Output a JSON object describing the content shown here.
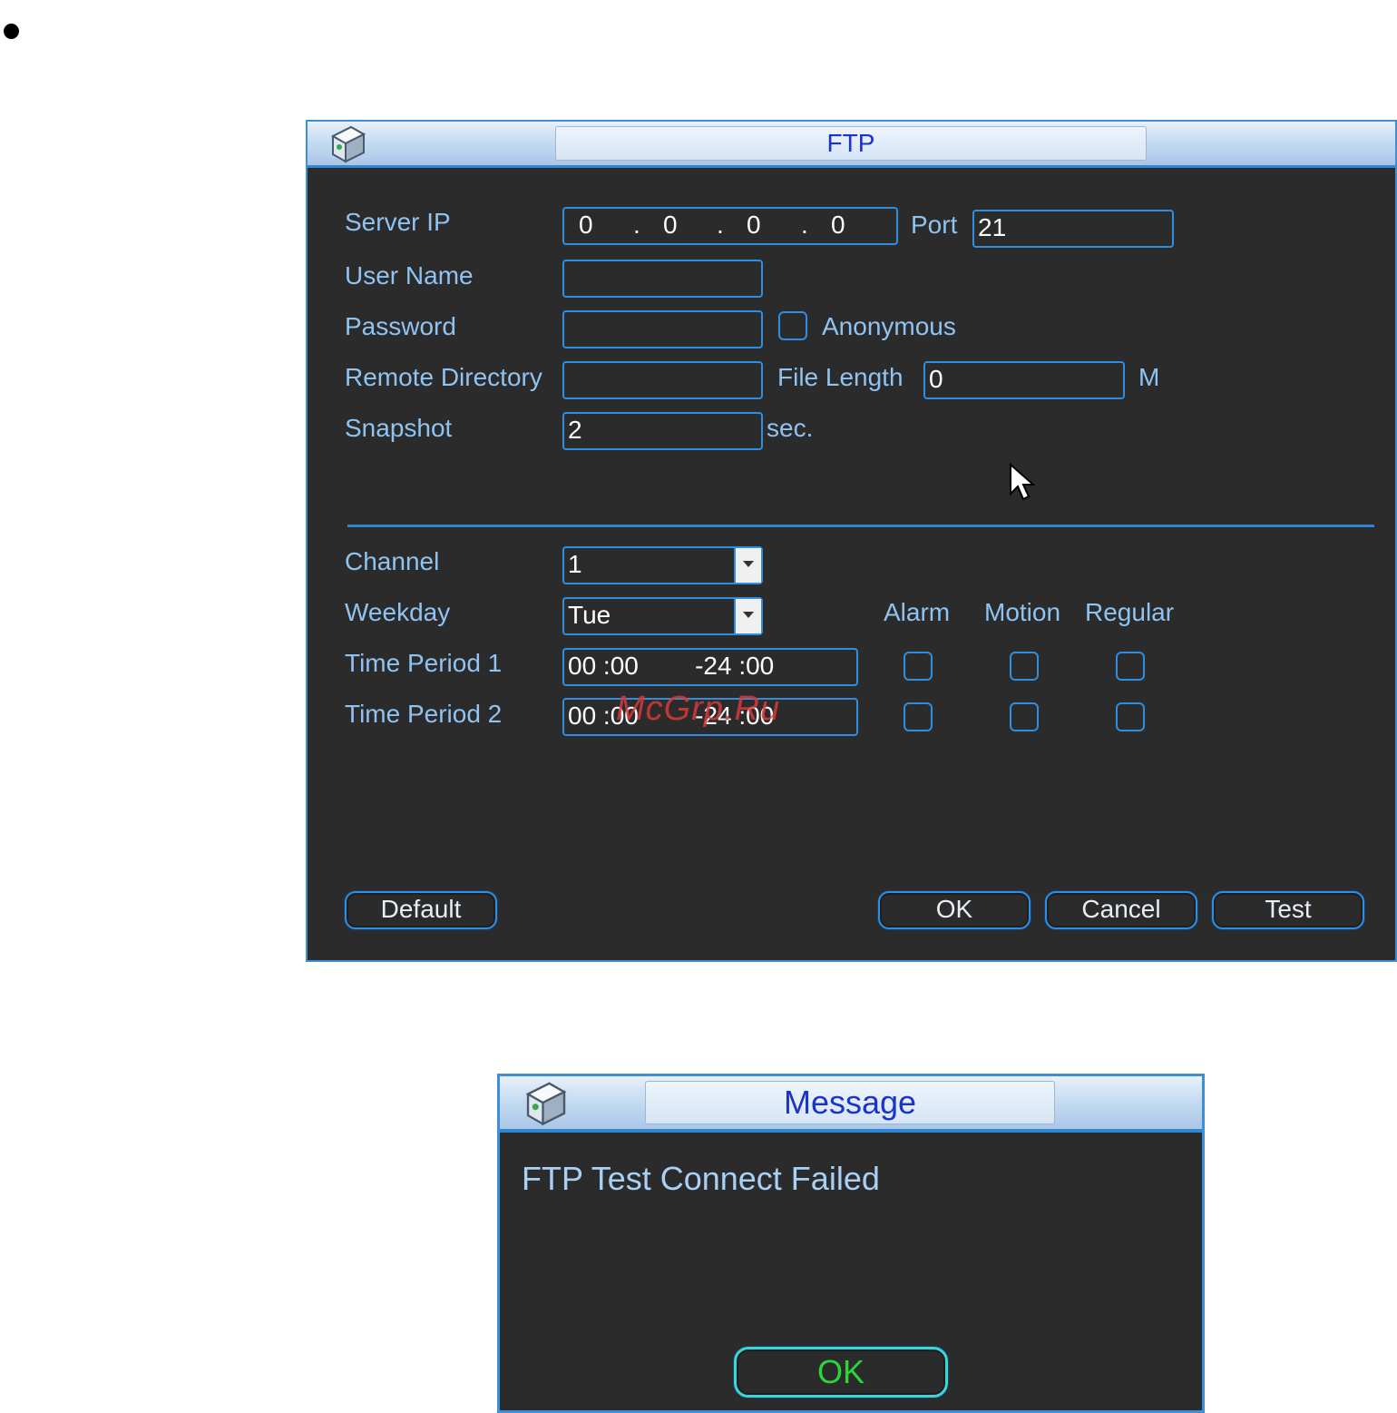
{
  "ftp_dialog": {
    "title": "FTP",
    "server_ip_label": "Server IP",
    "server_ip": [
      "0",
      "0",
      "0",
      "0"
    ],
    "ip_separator": ".",
    "port_label": "Port",
    "port_value": "21",
    "user_name_label": "User Name",
    "user_name_value": "",
    "password_label": "Password",
    "password_value": "",
    "anonymous_label": "Anonymous",
    "remote_directory_label": "Remote Directory",
    "remote_directory_value": "",
    "file_length_label": "File Length",
    "file_length_value": "0",
    "file_length_unit": "M",
    "snapshot_label": "Snapshot",
    "snapshot_value": "2",
    "snapshot_unit": "sec.",
    "channel_label": "Channel",
    "channel_value": "1",
    "weekday_label": "Weekday",
    "weekday_value": "Tue",
    "col_alarm": "Alarm",
    "col_motion": "Motion",
    "col_regular": "Regular",
    "period1_label": "Time Period 1",
    "period1_value": "00 :00        -24 :00",
    "period2_label": "Time Period 2",
    "period2_value": "00 :00        -24 :00",
    "default_button": "Default",
    "ok_button": "OK",
    "cancel_button": "Cancel",
    "test_button": "Test"
  },
  "message_dialog": {
    "title": "Message",
    "text": "FTP Test Connect Failed",
    "ok_button": "OK"
  },
  "watermark": "McGrp.Ru",
  "colors": {
    "panel_bg": "#2b2b2b",
    "border_blue": "#2e8fe0",
    "label_blue": "#8fc3f2",
    "title_blue": "#1a33c8",
    "ok_green": "#2bd63a"
  }
}
